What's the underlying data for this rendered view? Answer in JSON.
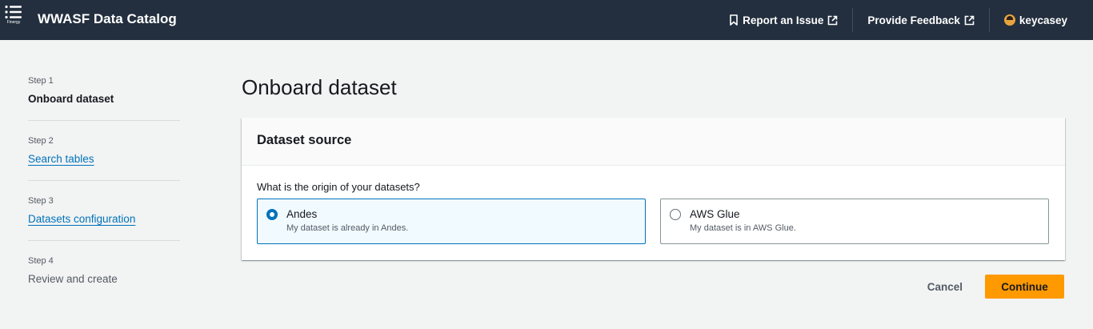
{
  "header": {
    "app_title": "WWASF Data Catalog",
    "brand_caption": "Finergy",
    "report_issue": "Report an Issue",
    "provide_feedback": "Provide Feedback",
    "username": "keycasey"
  },
  "steps": [
    {
      "number": "Step 1",
      "title": "Onboard dataset",
      "state": "current"
    },
    {
      "number": "Step 2",
      "title": "Search tables",
      "state": "link"
    },
    {
      "number": "Step 3",
      "title": "Datasets configuration",
      "state": "link"
    },
    {
      "number": "Step 4",
      "title": "Review and create",
      "state": "disabled"
    }
  ],
  "main": {
    "page_title": "Onboard dataset",
    "panel_title": "Dataset source",
    "question": "What is the origin of your datasets?",
    "options": [
      {
        "label": "Andes",
        "description": "My dataset is already in Andes.",
        "selected": true
      },
      {
        "label": "AWS Glue",
        "description": "My dataset is in AWS Glue.",
        "selected": false
      }
    ]
  },
  "actions": {
    "cancel": "Cancel",
    "continue": "Continue"
  },
  "colors": {
    "nav_bg": "#232f3e",
    "accent": "#0073bb",
    "primary_button": "#ff9900",
    "page_bg": "#f2f3f3"
  }
}
